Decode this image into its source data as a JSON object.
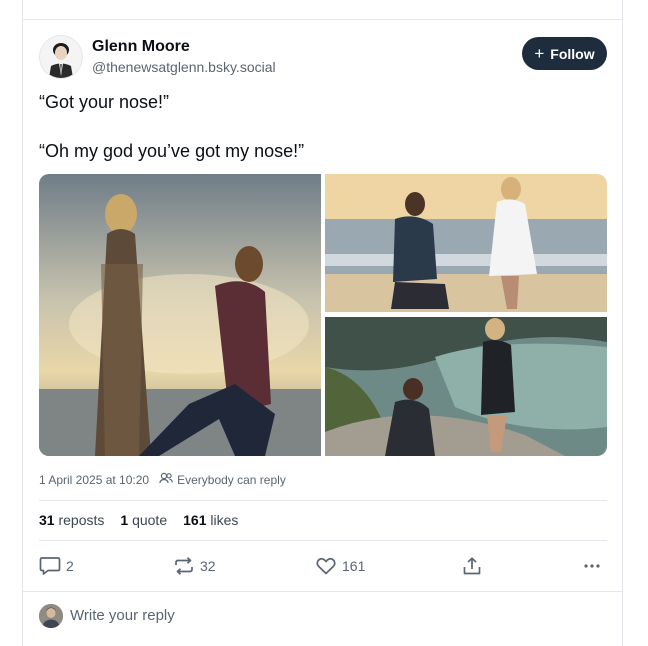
{
  "post": {
    "author_name": "Glenn Moore",
    "author_handle": "@thenewsatglenn.bsky.social",
    "follow_label": "Follow",
    "text_lines": [
      "“Got your nose!”",
      "“Oh my god you’ve got my nose!”"
    ],
    "timestamp": "1 April 2025 at 10:20",
    "reply_setting": "Everybody can reply"
  },
  "stats": {
    "reposts_count": "31",
    "reposts_label": "reposts",
    "quotes_count": "1",
    "quotes_label": "quote",
    "likes_count": "161",
    "likes_label": "likes"
  },
  "actions": {
    "replies": "2",
    "reposts": "32",
    "likes": "161"
  },
  "reply_box": {
    "placeholder": "Write your reply"
  },
  "icons": {
    "follow": "plus-icon",
    "reply_setting": "people-icon",
    "reply": "speech-bubble-icon",
    "repost": "repost-arrows-icon",
    "like": "heart-icon",
    "share": "share-upload-icon",
    "more": "ellipsis-icon"
  },
  "colors": {
    "follow_button_bg": "#1e2d3e",
    "icon_gray": "#5a6573",
    "divider": "#e3e7ec"
  }
}
